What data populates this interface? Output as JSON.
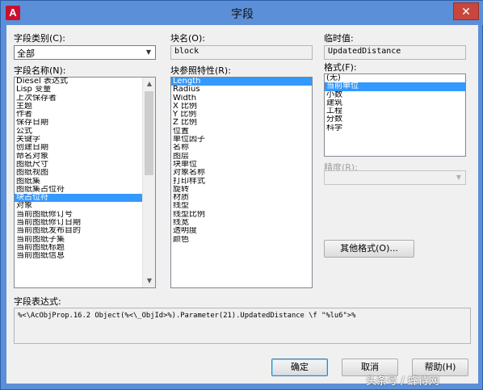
{
  "window": {
    "title": "字段",
    "close_glyph": "✕",
    "app_icon": "A"
  },
  "field_category": {
    "label": "字段类别(C):",
    "value": "全部"
  },
  "field_names": {
    "label": "字段名称(N):",
    "items": [
      "Diesel 表达式",
      "Lisp 变量",
      "上次保存者",
      "主题",
      "作者",
      "保存日期",
      "公式",
      "关键字",
      "创建日期",
      "命名对象",
      "图纸尺寸",
      "图纸视图",
      "图纸集",
      "图纸集占位符",
      "块占位符",
      "对象",
      "当前图纸修订号",
      "当前图纸修订日期",
      "当前图纸发布目的",
      "当前图纸子集",
      "当前图纸标题",
      "当前图纸信息"
    ],
    "selected_index": 14
  },
  "block_name": {
    "label": "块名(O):",
    "value": "block"
  },
  "block_ref_props": {
    "label": "块参照特性(R):",
    "items": [
      "Length",
      "Radius",
      "Width",
      "X 比例",
      "Y 比例",
      "Z 比例",
      "位置",
      "单位因子",
      "名称",
      "图层",
      "块单位",
      "对象名称",
      "打印样式",
      "旋转",
      "材质",
      "线型",
      "线型比例",
      "线宽",
      "透明度",
      "颜色"
    ],
    "selected_index": 0
  },
  "temp_value": {
    "label": "临时值:",
    "value": "UpdatedDistance"
  },
  "format": {
    "label": "格式(F):",
    "items": [
      "(无)",
      "当前单位",
      "小数",
      "建筑",
      "工程",
      "分数",
      "科学"
    ],
    "selected_index": 1
  },
  "precision": {
    "label": "精度(R):",
    "value": ""
  },
  "other_format_button": "其他格式(O)...",
  "field_expression": {
    "label": "字段表达式:",
    "value": "%<\\AcObjProp.16.2 Object(%<\\_ObjId>%).Parameter(21).UpdatedDistance \\f \"%lu6\">%"
  },
  "buttons": {
    "ok": "确定",
    "cancel": "取消",
    "help": "帮助(H)"
  },
  "watermark": "头条号 / 蜂待网"
}
